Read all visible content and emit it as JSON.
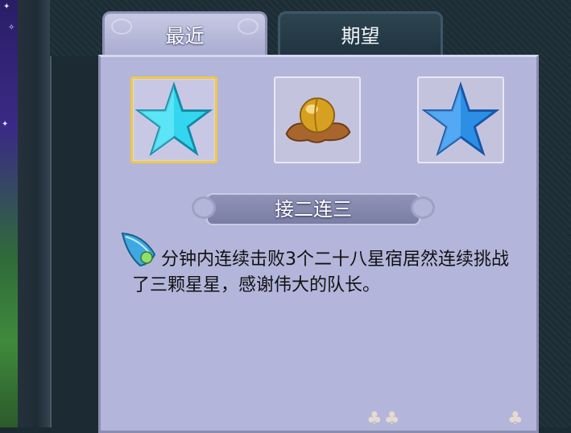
{
  "tabs": [
    {
      "label": "最近",
      "active": true
    },
    {
      "label": "期望",
      "active": false
    }
  ],
  "items": [
    {
      "icon": "cyan-star-icon",
      "selected": true
    },
    {
      "icon": "golden-orb-icon",
      "selected": false
    },
    {
      "icon": "blue-star-icon",
      "selected": false
    }
  ],
  "achievement": {
    "title": "接二连三",
    "description": "分钟内连续击败3个二十八星宿居然连续挑战了三颗星星，感谢伟大的队长。"
  },
  "colors": {
    "panel": "#b3b6da",
    "selected_border": "#f2c64a",
    "tab_active": "#b8bad9",
    "tab_inactive": "#263c48"
  }
}
